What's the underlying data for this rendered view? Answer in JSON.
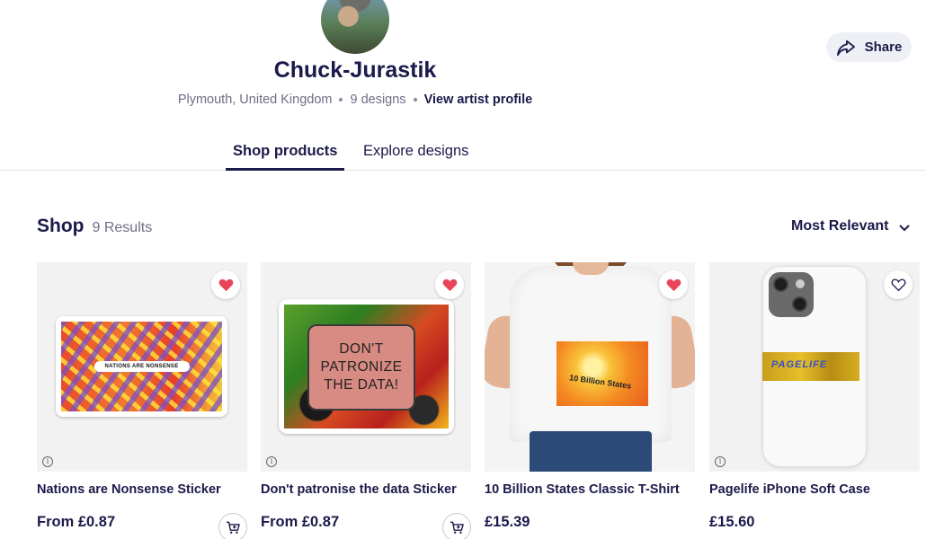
{
  "artist": {
    "name": "Chuck-Jurastik",
    "location": "Plymouth, United Kingdom",
    "designs": "9 designs",
    "profile_link": "View artist profile"
  },
  "share": {
    "label": "Share"
  },
  "tabs": [
    {
      "label": "Shop products",
      "active": true
    },
    {
      "label": "Explore designs",
      "active": false
    }
  ],
  "shop": {
    "title": "Shop",
    "count": "9 Results",
    "sort": "Most Relevant"
  },
  "products": [
    {
      "name": "Nations are Nonsense Sticker",
      "price": "From £0.87",
      "favorited": true,
      "art_text": "NATIONS ARE NONSENSE",
      "has_cart": true
    },
    {
      "name": "Don't patronise the data Sticker",
      "price": "From £0.87",
      "favorited": true,
      "art_text": "DON'T PATRONIZE THE DATA!",
      "has_cart": true
    },
    {
      "name": "10 Billion States Classic T-Shirt",
      "price": "£15.39",
      "favorited": true,
      "art_text": "10 Billion States",
      "has_cart": false
    },
    {
      "name": "Pagelife iPhone Soft Case",
      "price": "£15.60",
      "favorited": false,
      "art_text": "PAGELIFE",
      "has_cart": false
    }
  ],
  "colors": {
    "heart_filled": "#e8455a",
    "text_primary": "#1b1a4a",
    "text_muted": "#6e6d86"
  }
}
